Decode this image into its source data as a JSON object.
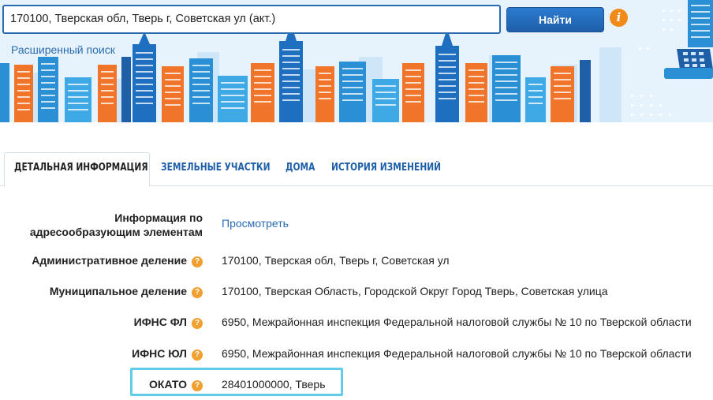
{
  "search": {
    "query": "170100, Тверская обл, Тверь г, Советская ул (акт.)",
    "button_label": "Найти",
    "info_symbol": "i",
    "advanced_link": "Расширенный поиск"
  },
  "tabs": [
    {
      "label": "ДЕТАЛЬНАЯ ИНФОРМАЦИЯ",
      "active": true
    },
    {
      "label": "ЗЕМЕЛЬНЫЕ УЧАСТКИ",
      "active": false
    },
    {
      "label": "ДОМА",
      "active": false
    },
    {
      "label": "ИСТОРИЯ ИЗМЕНЕНИЙ",
      "active": false
    }
  ],
  "details": {
    "help_symbol": "?",
    "rows": [
      {
        "label_line1": "Информация по",
        "label_line2": "адресообразующим элементам",
        "value": "Просмотреть"
      },
      {
        "label": "Административное деление",
        "value": "170100, Тверская обл, Тверь г, Советская ул"
      },
      {
        "label": "Муниципальное деление",
        "value": "170100, Тверская Область, Городской Округ Город Тверь, Советская улица"
      },
      {
        "label": "ИФНС ФЛ",
        "value": "6950, Межрайонная инспекция Федеральной налоговой службы № 10 по Тверской области"
      },
      {
        "label": "ИФНС ЮЛ",
        "value": "6950, Межрайонная инспекция Федеральной налоговой службы № 10 по Тверской области"
      },
      {
        "label": "ОКАТО",
        "value": "28401000000, Тверь"
      }
    ]
  },
  "colors": {
    "accent_blue": "#1e5fa8",
    "link_blue": "#2a6bb0",
    "orange": "#f28a1a",
    "highlight": "#62cde8"
  }
}
